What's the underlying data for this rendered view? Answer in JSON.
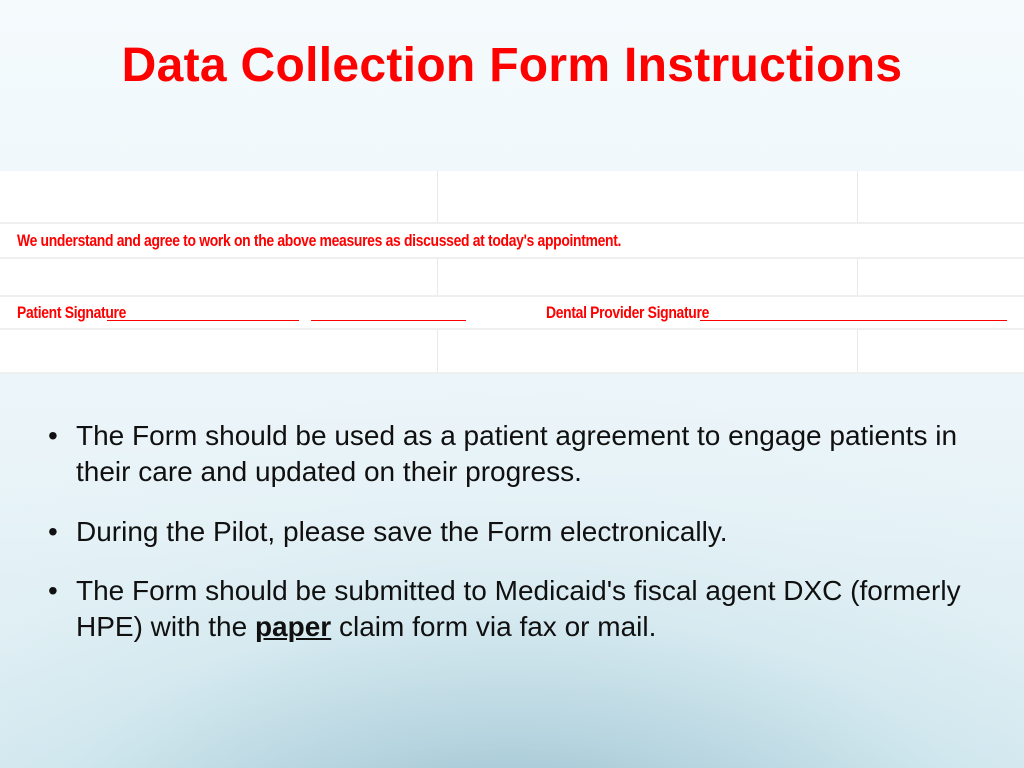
{
  "title": "Data Collection Form Instructions",
  "form": {
    "agreement_text": "We understand and agree to work on the above measures as discussed at today's appointment.",
    "patient_signature_label": "Patient Signature",
    "dental_signature_label": "Dental Provider Signature"
  },
  "bullets": {
    "items": [
      {
        "text": "The Form should be used as a patient agreement to engage patients in their care and updated on their progress."
      },
      {
        "text": "During the Pilot, please save the Form electronically."
      },
      {
        "pre": "The Form should be submitted to Medicaid's fiscal agent DXC (formerly HPE) with the ",
        "emph": "paper",
        "post": " claim form via fax or mail."
      }
    ]
  }
}
